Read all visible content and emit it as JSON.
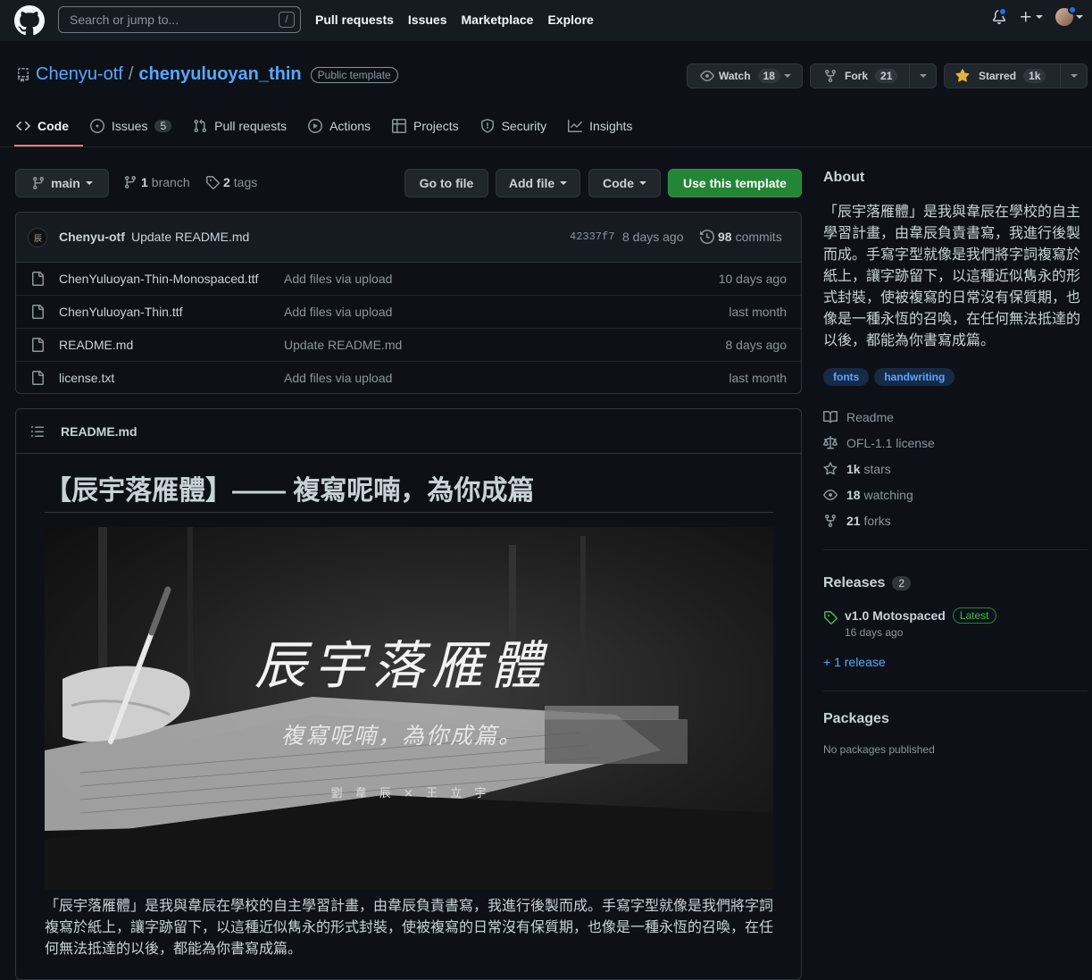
{
  "header": {
    "search_placeholder": "Search or jump to...",
    "search_shortcut": "/",
    "nav": [
      "Pull requests",
      "Issues",
      "Marketplace",
      "Explore"
    ]
  },
  "repo": {
    "owner": "Chenyu-otf",
    "separator": "/",
    "name": "chenyuluoyan_thin",
    "visibility": "Public template",
    "watch_label": "Watch",
    "watch_count": "18",
    "fork_label": "Fork",
    "fork_count": "21",
    "star_label": "Starred",
    "star_count": "1k"
  },
  "tabs": [
    {
      "label": "Code",
      "icon": "code-icon",
      "active": true
    },
    {
      "label": "Issues",
      "icon": "issue-opened-icon",
      "count": "5"
    },
    {
      "label": "Pull requests",
      "icon": "git-pull-request-icon"
    },
    {
      "label": "Actions",
      "icon": "play-icon"
    },
    {
      "label": "Projects",
      "icon": "table-icon"
    },
    {
      "label": "Security",
      "icon": "shield-icon"
    },
    {
      "label": "Insights",
      "icon": "graph-icon"
    }
  ],
  "branchbar": {
    "branch": "main",
    "branch_count": "1",
    "branch_word": "branch",
    "tag_count": "2",
    "tag_word": "tags",
    "go_to_file": "Go to file",
    "add_file": "Add file",
    "code": "Code",
    "use_template": "Use this template"
  },
  "commit": {
    "author": "Chenyu-otf",
    "message": "Update README.md",
    "sha": "42337f7",
    "age": "8 days ago",
    "count": "98",
    "count_word": "commits"
  },
  "files": [
    {
      "name": "ChenYuluoyan-Thin-Monospaced.ttf",
      "message": "Add files via upload",
      "age": "10 days ago"
    },
    {
      "name": "ChenYuluoyan-Thin.ttf",
      "message": "Add files via upload",
      "age": "last month"
    },
    {
      "name": "README.md",
      "message": "Update README.md",
      "age": "8 days ago"
    },
    {
      "name": "license.txt",
      "message": "Add files via upload",
      "age": "last month"
    }
  ],
  "readme": {
    "filename": "README.md",
    "title": "【辰宇落雁體】—— 複寫呢喃，為你成篇",
    "hero_title": "辰宇落雁體",
    "hero_subtitle": "複寫呢喃，為你成篇。",
    "hero_credit": "劉 韋 辰  ×  王 立 宇",
    "paragraph": "「辰宇落雁體」是我與韋辰在學校的自主學習計畫，由韋辰負責書寫，我進行後製而成。手寫字型就像是我們將字詞複寫於紙上，讓字跡留下，以這種近似雋永的形式封裝，使被複寫的日常沒有保質期，也像是一種永恆的召喚，在任何無法抵達的以後，都能為你書寫成篇。"
  },
  "about": {
    "heading": "About",
    "description": "「辰宇落雁體」是我與韋辰在學校的自主學習計畫，由韋辰負責書寫，我進行後製而成。手寫字型就像是我們將字詞複寫於紙上，讓字跡留下，以這種近似雋永的形式封裝，使被複寫的日常沒有保質期，也像是一種永恆的召喚，在任何無法抵達的以後，都能為你書寫成篇。",
    "topics": [
      "fonts",
      "handwriting"
    ],
    "readme": "Readme",
    "license": "OFL-1.1 license",
    "stars_num": "1k",
    "stars_word": "stars",
    "watching_num": "18",
    "watching_word": "watching",
    "forks_num": "21",
    "forks_word": "forks"
  },
  "releases": {
    "heading": "Releases",
    "count": "2",
    "latest_name": "v1.0 Motospaced",
    "latest_badge": "Latest",
    "latest_age": "16 days ago",
    "more": "+ 1 release"
  },
  "packages": {
    "heading": "Packages",
    "empty": "No packages published"
  },
  "colors": {
    "bg": "#0d1117",
    "link": "#58a6ff",
    "green": "#238636",
    "tab_underline": "#f78166"
  }
}
